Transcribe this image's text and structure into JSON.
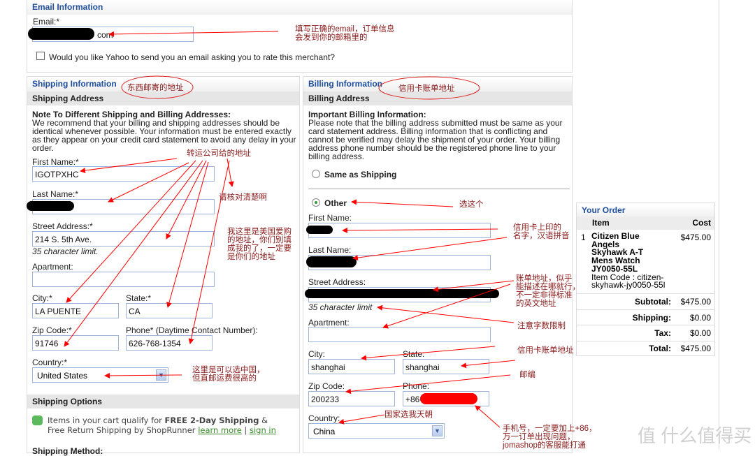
{
  "email_section": {
    "title": "Email Information",
    "email_label": "Email:*",
    "email_value": "com",
    "rate_label": "Would you like Yahoo to send you an email asking you to rate this merchant?",
    "rate_checked": false
  },
  "shipping": {
    "title": "Shipping Information",
    "subtitle": "Shipping Address",
    "note_title": "Note To Different Shipping and Billing Addresses:",
    "note_lines": [
      "We recommend that your billing and shipping addresses should be",
      "identical whenever possible. Your information must be entered exactly",
      "as they appear on your credit card statement to avoid any delay in your",
      "order."
    ],
    "first_name_label": "First Name:*",
    "first_name": "IGOTPXHC",
    "last_name_label": "Last Name:*",
    "street_label": "Street Address:*",
    "street": "214 S. 5th Ave.",
    "char_limit": "35 character limit.",
    "apartment_label": "Apartment:",
    "city_label": "City:*",
    "city": "LA PUENTE",
    "state_label": "State:*",
    "state": "CA",
    "zip_label": "Zip Code:*",
    "zip": "91746",
    "phone_label": "Phone* (Daytime Contact Number):",
    "phone": "626-768-1354",
    "country_label": "Country:*",
    "country": "United States",
    "options_title": "Shipping Options",
    "shoprunner_1a": "Items in your cart qualify for ",
    "shoprunner_1b": "FREE 2-Day Shipping",
    "shoprunner_1c": " &",
    "shoprunner_2": "Free Return Shipping by ShopRunner ",
    "learn_more": "learn more",
    "sep": " | ",
    "sign_in": "sign in",
    "method_label": "Shipping Method:"
  },
  "billing": {
    "title": "Billing Information",
    "subtitle": "Billing Address",
    "note_title": "Important Billing Information:",
    "note_lines": [
      "Please note that the billing address submitted must be same as your",
      "card statement address. Billing information that is conflicting and",
      "cannot be verified may delay the shipment of your order. Your billing",
      "address phone number should be the registered phone line to your",
      "billing address."
    ],
    "same_label": "Same as Shipping",
    "other_label": "Other",
    "selected": "Other",
    "first_name_label": "First Name:",
    "last_name_label": "Last Name:",
    "street_label": "Street Address:",
    "char_limit": "35 character limit",
    "apartment_label": "Apartment:",
    "city_label": "City:",
    "city": "shanghai",
    "state_label": "State:",
    "state": "shanghai",
    "zip_label": "Zip Code:",
    "zip": "200233",
    "phone_label": "Phone:",
    "phone": "+86-",
    "country_label": "Country:",
    "country": "China"
  },
  "order": {
    "title": "Your Order",
    "col_item": "Item",
    "col_cost": "Cost",
    "items": [
      {
        "qty": "1",
        "name_lines": [
          "Citizen Blue",
          "Angels",
          "Skyhawk A-T",
          "Mens Watch",
          "JY0050-55L"
        ],
        "code_lines": [
          "Item Code : citizen-",
          "skyhawk-jy0050-55l"
        ],
        "cost": "$475.00"
      }
    ],
    "subtotal_label": "Subtotal:",
    "subtotal": "$475.00",
    "shipping_label": "Shipping:",
    "shipping": "$0.00",
    "tax_label": "Tax:",
    "tax": "$0.00",
    "total_label": "Total:",
    "total": "$475.00"
  },
  "annotations": {
    "email": [
      "填写正确的email，订单信息",
      "会发到你的邮箱里的"
    ],
    "ship_circle": "东西邮寄的地址",
    "bill_circle": "信用卡账单地址",
    "forwarder": "转运公司给的地址",
    "check": "请核对清楚啊",
    "mine": [
      "我这里是美国爱购",
      "的地址，你们别填",
      "成我的了，一定要",
      "是你们的地址"
    ],
    "country_cn": [
      "这里是可以选中国，",
      "但直邮运费很高的"
    ],
    "choose": "选这个",
    "card_name": [
      "信用卡上印的",
      "名字，汉语拼音"
    ],
    "bill_addr": [
      "账单地址，似乎",
      "能描述在哪就行，",
      "不一定非得标准",
      "的英文地址"
    ],
    "limit": "注意字数限制",
    "card_bill": "信用卡账单地址",
    "zip": "邮编",
    "country_pick": "国家选我天朝",
    "phone": [
      "手机号，一定要加上+86，",
      "万一订单出现问题，",
      "jomashop的客服能打通"
    ]
  },
  "watermark": "值 什么值得买",
  "colors": {
    "header_blue": "#1f4e9c",
    "annotation": "#8b1a1a",
    "arrow": "#ff0000"
  }
}
